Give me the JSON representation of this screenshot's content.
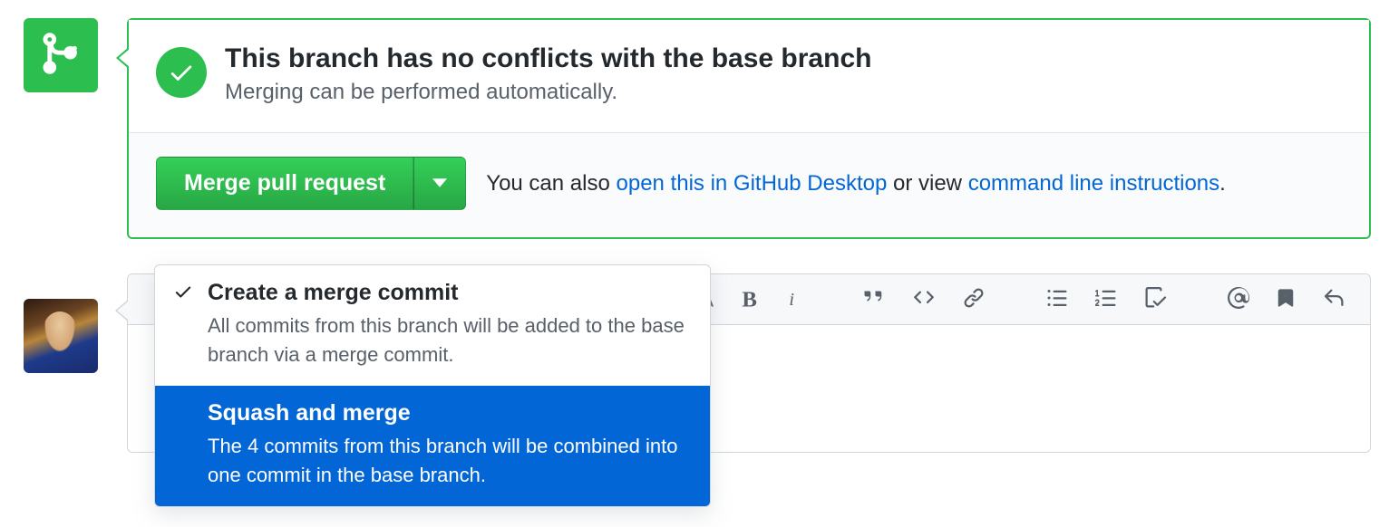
{
  "status": {
    "title": "This branch has no conflicts with the base branch",
    "subtitle": "Merging can be performed automatically."
  },
  "merge_button": {
    "label": "Merge pull request"
  },
  "help": {
    "prefix": "You can also ",
    "link1": "open this in GitHub Desktop",
    "middle": " or view ",
    "link2": "command line instructions",
    "suffix": "."
  },
  "dropdown": {
    "options": [
      {
        "title": "Create a merge commit",
        "desc": "All commits from this branch will be added to the base branch via a merge commit.",
        "checked": true,
        "selected": false
      },
      {
        "title": "Squash and merge",
        "desc": "The 4 commits from this branch will be combined into one commit in the base branch.",
        "checked": false,
        "selected": true
      }
    ]
  }
}
